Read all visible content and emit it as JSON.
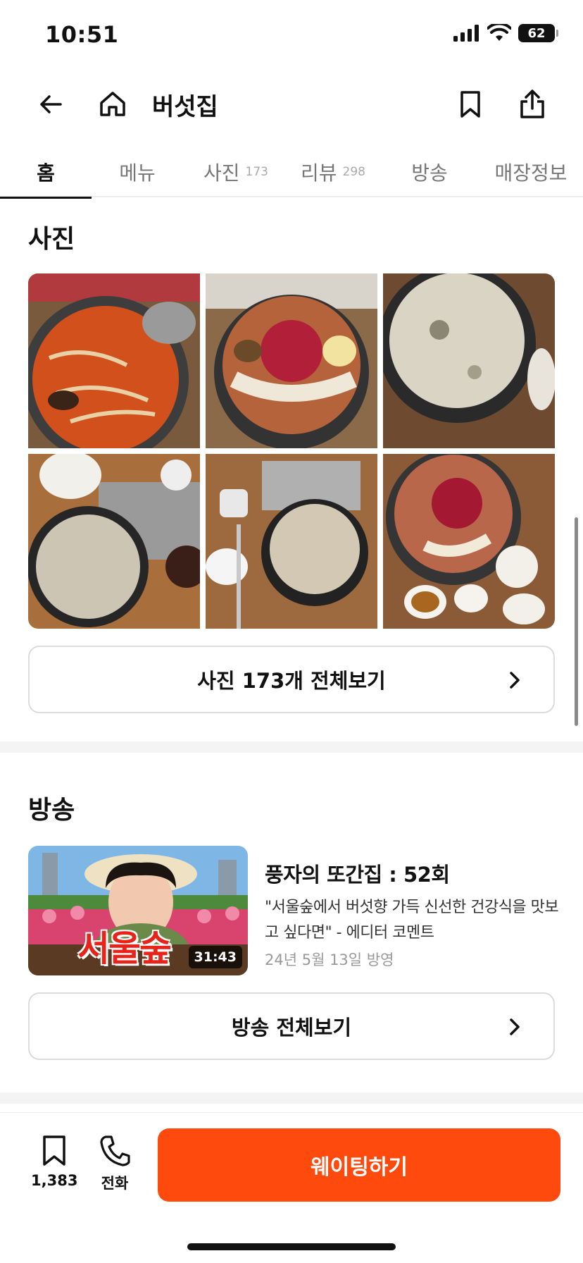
{
  "status": {
    "time": "10:51",
    "battery": "62"
  },
  "header": {
    "title": "버섯집",
    "icons": {
      "back": "arrow-left-icon",
      "home": "home-icon",
      "bookmark": "bookmark-icon",
      "share": "share-icon"
    }
  },
  "tabs": [
    {
      "label": "홈",
      "count": ""
    },
    {
      "label": "메뉴",
      "count": ""
    },
    {
      "label": "사진",
      "count": "173"
    },
    {
      "label": "리뷰",
      "count": "298"
    },
    {
      "label": "방송",
      "count": ""
    },
    {
      "label": "매장정보",
      "count": ""
    }
  ],
  "photos": {
    "title": "사진",
    "view_all_label": "사진 173개 전체보기",
    "items": [
      "spicy mushroom hotpot",
      "raw beef and mushroom platter",
      "mushroom broth pot",
      "rice and stew table",
      "stew with spoon",
      "beef mushroom platter with side dishes"
    ]
  },
  "broadcast": {
    "title": "방송",
    "episode_title": "풍자의 또간집 : 52회",
    "description": "\"서울숲에서 버섯향 가득 신선한 건강식을 맛보고 싶다면\" - 에디터 코멘트",
    "date": "24년 5월 13일 방영",
    "duration": "31:43",
    "thumb_text": "서울숲",
    "view_all_label": "방송 전체보기"
  },
  "bottom_bar": {
    "save_count": "1,383",
    "call_label": "전화",
    "cta_label": "웨이팅하기",
    "accent_color": "#ff4a0d"
  }
}
